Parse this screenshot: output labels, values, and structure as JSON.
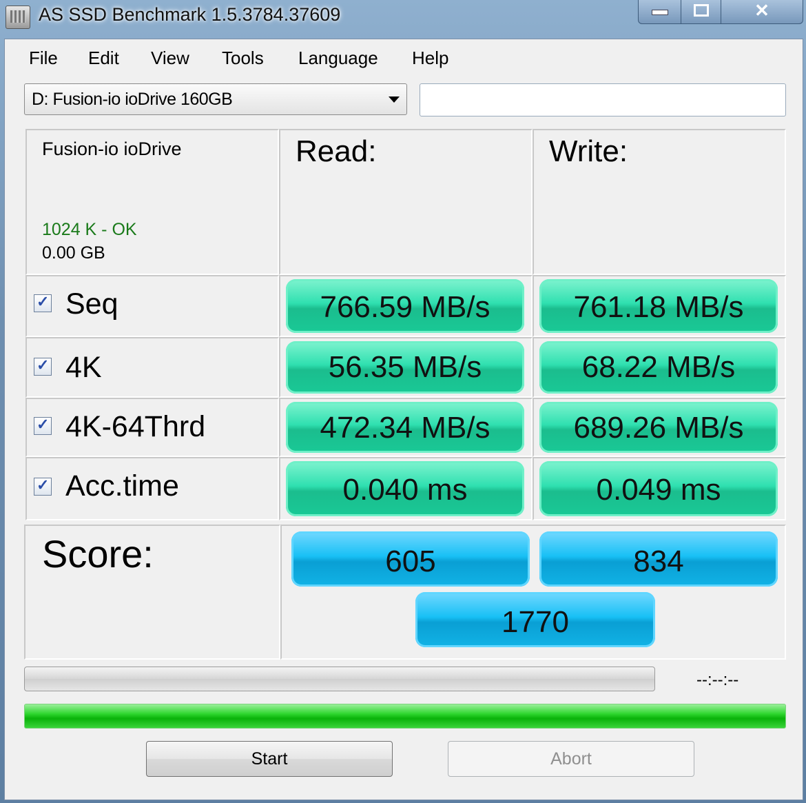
{
  "window": {
    "title": "AS SSD Benchmark 1.5.3784.37609"
  },
  "menu": [
    "File",
    "Edit",
    "View",
    "Tools",
    "Language",
    "Help"
  ],
  "drive_select": {
    "value": "D: Fusion-io ioDrive 160GB"
  },
  "text_box": {
    "value": ""
  },
  "info": {
    "drive_name": "Fusion-io ioDrive",
    "status": "1024 K - OK",
    "size": "0.00 GB"
  },
  "headers": {
    "read": "Read:",
    "write": "Write:"
  },
  "rows": [
    {
      "label": "Seq",
      "checked": true,
      "read": "766.59 MB/s",
      "write": "761.18 MB/s"
    },
    {
      "label": "4K",
      "checked": true,
      "read": "56.35 MB/s",
      "write": "68.22 MB/s"
    },
    {
      "label": "4K-64Thrd",
      "checked": true,
      "read": "472.34 MB/s",
      "write": "689.26 MB/s"
    },
    {
      "label": "Acc.time",
      "checked": true,
      "read": "0.040 ms",
      "write": "0.049 ms"
    }
  ],
  "score": {
    "label": "Score:",
    "read": "605",
    "write": "834",
    "total": "1770"
  },
  "progress": {
    "time": "--:--:--",
    "main_fraction": 1.0
  },
  "buttons": {
    "start": "Start",
    "abort": "Abort"
  },
  "colors": {
    "result_green": "#2fe0b0",
    "score_blue": "#18c0f5",
    "progress_green": "#2fd62f",
    "ok_text": "#1a7a1a"
  }
}
